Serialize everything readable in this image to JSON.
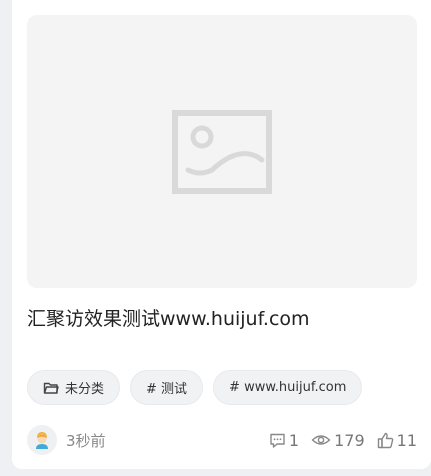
{
  "post": {
    "title": "汇聚访效果测试www.huijuf.com",
    "thumbnail_icon": "image-placeholder-icon",
    "tags": [
      {
        "icon": "folder-icon",
        "label": "未分类"
      },
      {
        "icon": "",
        "label": "# 测试"
      },
      {
        "icon": "",
        "label": "# www.huijuf.com"
      }
    ],
    "author": {
      "avatar_icon": "avatar-icon",
      "time": "3秒前"
    },
    "stats": {
      "comments": "1",
      "views": "179",
      "likes": "11"
    }
  },
  "colors": {
    "background": "#eef0f4",
    "card": "#ffffff",
    "thumbnail": "#f4f4f4",
    "tag_bg": "#f1f2f4",
    "muted_text": "#888888"
  }
}
